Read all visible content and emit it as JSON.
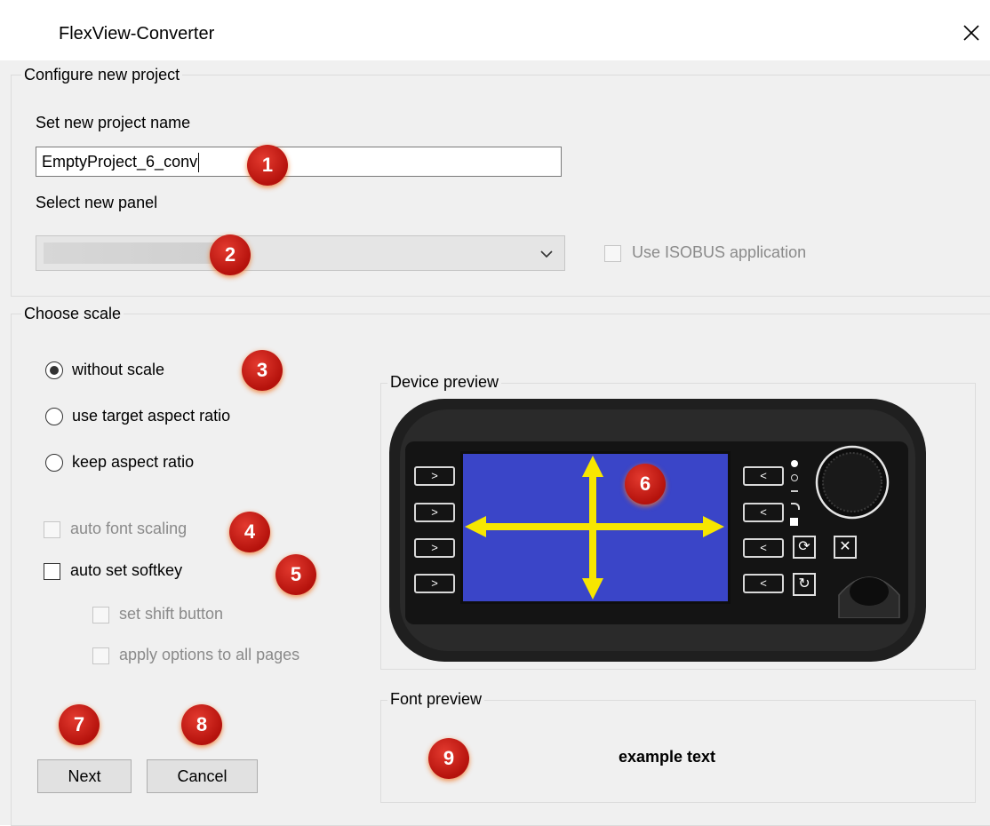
{
  "window": {
    "title": "FlexView-Converter"
  },
  "configure": {
    "legend": "Configure new project",
    "name_label": "Set new project name",
    "name_value": "EmptyProject_6_conv",
    "panel_label": "Select new panel",
    "isobus_label": "Use ISOBUS application"
  },
  "scale": {
    "legend": "Choose scale",
    "options": [
      "without scale",
      "use target aspect ratio",
      "keep aspect ratio"
    ],
    "selected_option": "without scale",
    "auto_font_scaling": "auto font scaling",
    "auto_set_softkey": "auto set softkey",
    "set_shift_button": "set shift button",
    "apply_options": "apply options to all pages"
  },
  "device_preview": {
    "legend": "Device preview"
  },
  "font_preview": {
    "legend": "Font preview",
    "sample": "example text"
  },
  "buttons": {
    "next": "Next",
    "cancel": "Cancel"
  },
  "callouts": [
    "1",
    "2",
    "3",
    "4",
    "5",
    "6",
    "7",
    "8",
    "9"
  ],
  "icons": {
    "close": "close-icon",
    "dropdown": "chevron-down-icon",
    "softkey": "softkey-arrow-icon",
    "arrows": "four-way-arrow-icon",
    "knob": "rotary-knob-icon"
  },
  "colors": {
    "screen_blue": "#3a45c8",
    "arrow_yellow": "#f7e600",
    "callout_red": "#c9201a",
    "device_body": "#1f1f1f"
  }
}
